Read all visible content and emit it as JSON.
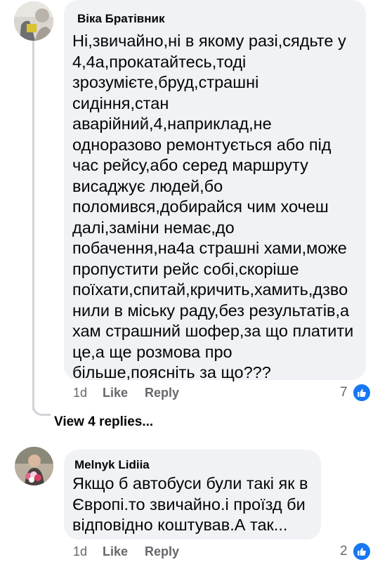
{
  "comments": [
    {
      "author": "Віка Братівник",
      "text": "Ні,звичайно,ні в якому разі,сядьте у\n4,4а,прокатайтесь,тоді\nзрозумієте,бруд,страшні\nсидіння,стан\nаварійний,4,наприклад,не\nодноразово ремонтується або під\nчас рейсу,або серед маршруту\nвисаджує людей,бо\nполомився,добирайся чим хочеш\nдалі,заміни немає,до\nпобачення,на4а страшні хами,може\nпропустити рейс собі,скоріше\nпоїхати,спитай,кричить,хамить,дзво\nнили в міську раду,без результатів,а\nхам страшний шофер,за що платити\nце,а ще розмова про\nбільше,поясніть за що???",
      "time": "1d",
      "like_label": "Like",
      "reply_label": "Reply",
      "reaction_count": "7",
      "avatar_icon": "profile-photo",
      "reaction_icon": "thumbs-up-icon"
    },
    {
      "author": "Melnyk Lidiia",
      "text": "Якщо б автобуси були такі як в\nЄвропі.то звичайно.і проїзд би\nвідповідно коштував.А так...",
      "time": "1d",
      "like_label": "Like",
      "reply_label": "Reply",
      "reaction_count": "2",
      "avatar_icon": "profile-photo",
      "reaction_icon": "thumbs-up-icon"
    }
  ],
  "view_replies_label": "View 4 replies...",
  "colors": {
    "bubble": "#f0f2f5",
    "like_blue": "#1877f2",
    "meta_gray": "#65676b"
  }
}
